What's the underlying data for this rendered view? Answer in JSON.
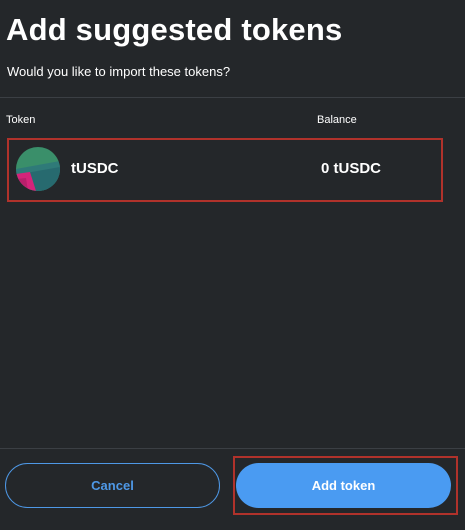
{
  "header": {
    "title": "Add suggested tokens",
    "subtitle": "Would you like to import these tokens?"
  },
  "table": {
    "columns": [
      "Token",
      "Balance"
    ],
    "rows": [
      {
        "symbol": "tUSDC",
        "balance": "0 tUSDC",
        "icon": "token-identicon"
      }
    ]
  },
  "footer": {
    "cancel_label": "Cancel",
    "add_label": "Add token"
  },
  "colors": {
    "background": "#24272a",
    "accent": "#4a9bf2",
    "highlight_border": "#b0322b"
  }
}
